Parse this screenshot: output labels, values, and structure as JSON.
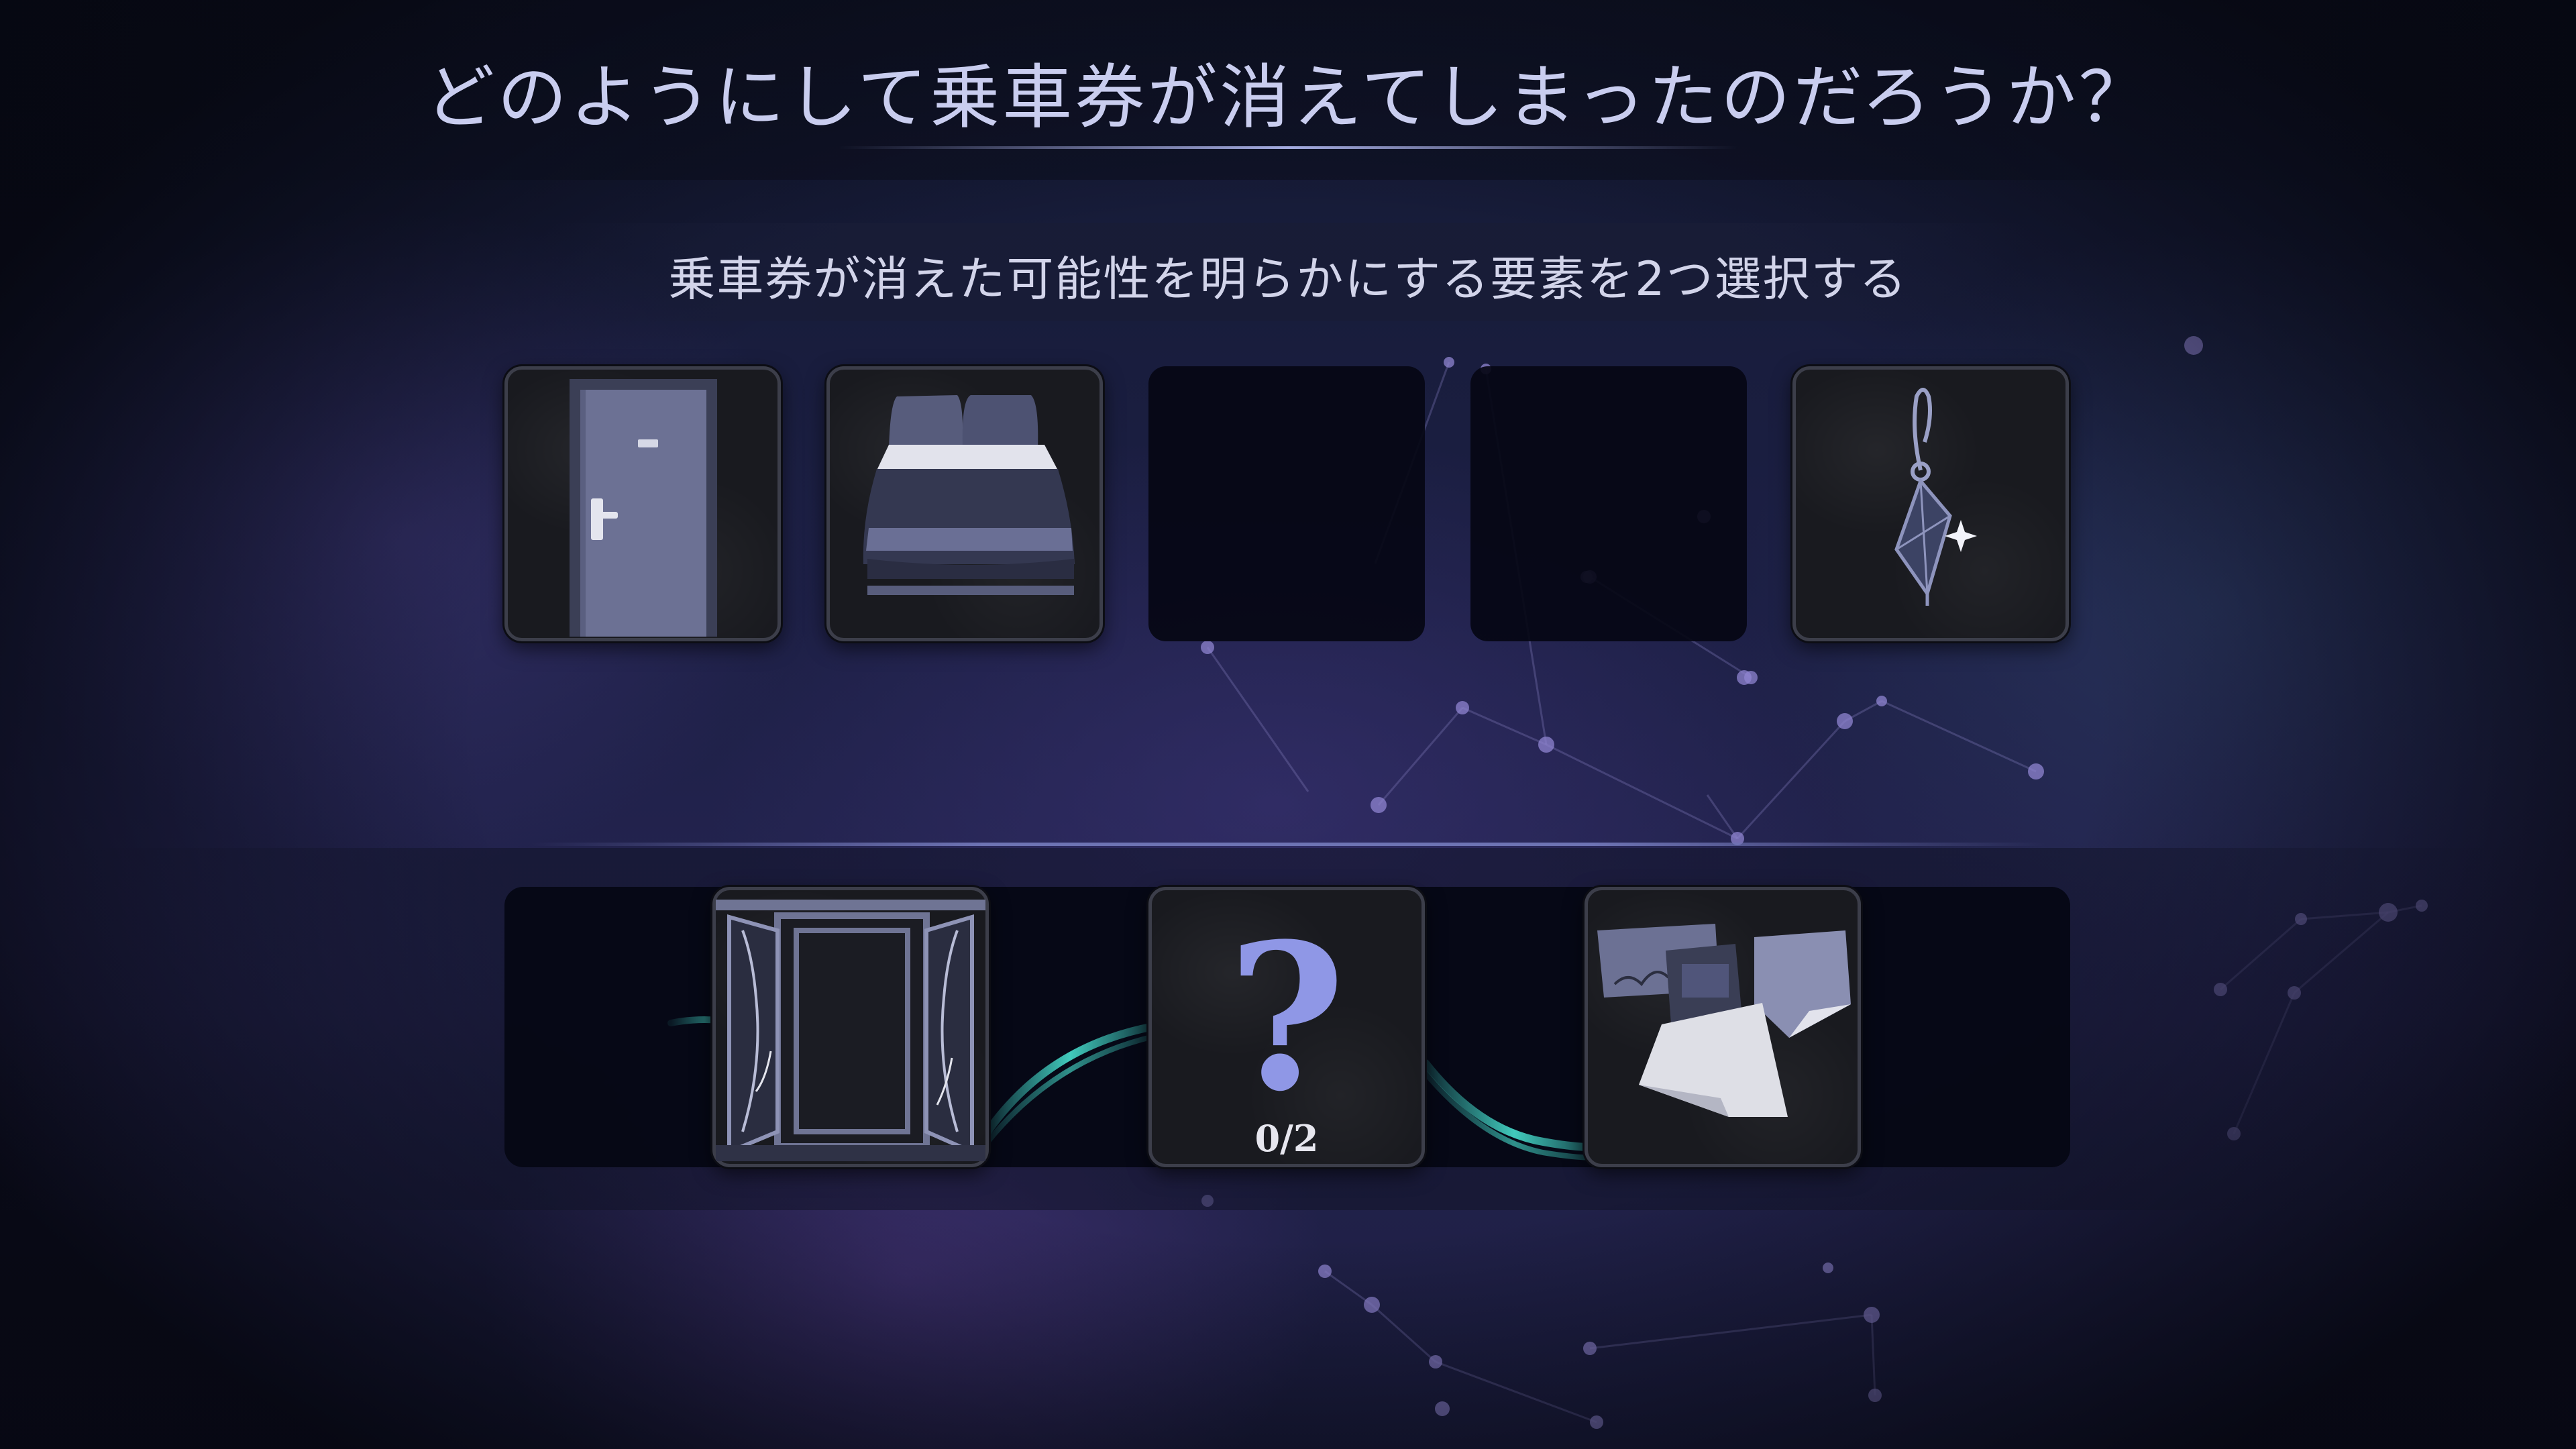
{
  "header": {
    "title": "どのようにして乗車券が消えてしまったのだろうか？",
    "instruction": "乗車券が消えた可能性を明らかにする要素を2つ選択する"
  },
  "element_cards": [
    {
      "icon": "door-icon",
      "state": "available"
    },
    {
      "icon": "bed-icon",
      "state": "available"
    },
    {
      "icon": "",
      "state": "empty"
    },
    {
      "icon": "",
      "state": "empty"
    },
    {
      "icon": "earring-icon",
      "state": "available"
    }
  ],
  "deduction_chain": [
    {
      "icon": "open-window-icon",
      "state": "placed"
    },
    {
      "icon": "question-mark-icon",
      "state": "pending",
      "symbol": "?",
      "progress": "0/2"
    },
    {
      "icon": "scattered-papers-icon",
      "state": "placed"
    }
  ],
  "colors": {
    "title_text": "#c9cdef",
    "accent_question": "#8f97e6",
    "wave_teal": "#3fd8c8",
    "card_border": "#3c3e4a"
  }
}
